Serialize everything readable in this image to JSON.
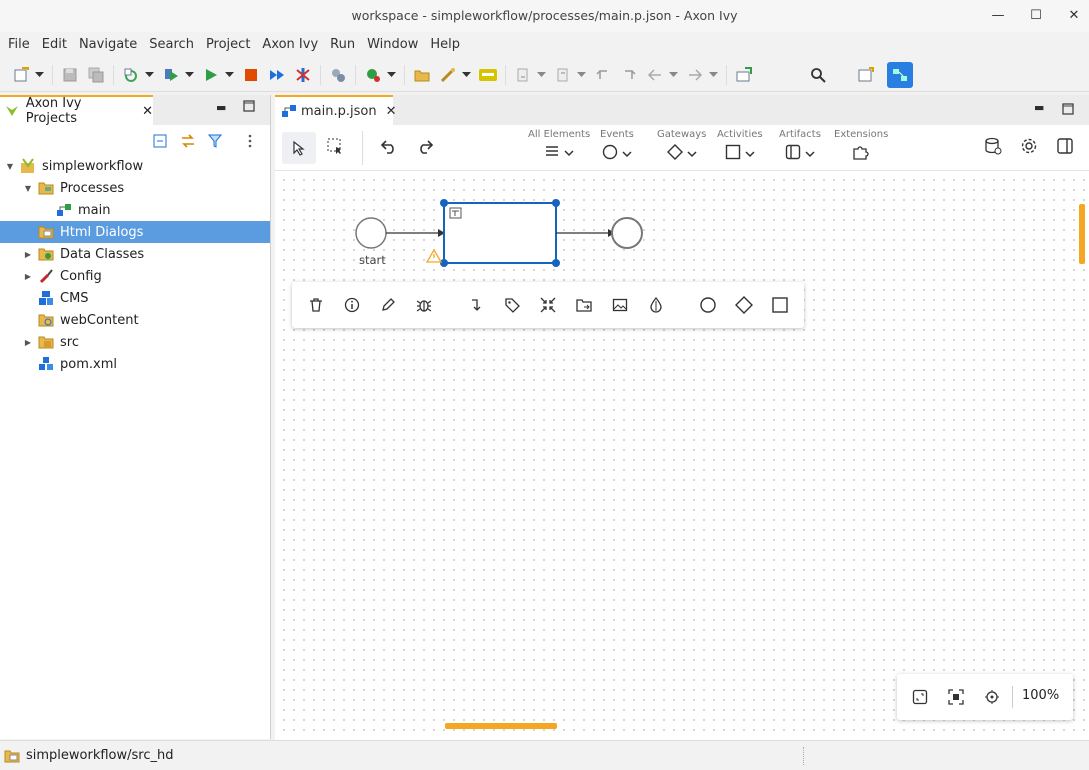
{
  "window": {
    "title": "workspace - simpleworkflow/processes/main.p.json - Axon Ivy",
    "minimize_icon": "minimize-icon",
    "maximize_icon": "maximize-icon",
    "close_icon": "close-icon"
  },
  "menu": [
    "File",
    "Edit",
    "Navigate",
    "Search",
    "Project",
    "Axon Ivy",
    "Run",
    "Window",
    "Help"
  ],
  "left_panel": {
    "tab_label": "Axon Ivy Projects",
    "tree": [
      {
        "label": "simpleworkflow",
        "icon": "project-icon"
      },
      {
        "label": "Processes",
        "icon": "folder-icon"
      },
      {
        "label": "main",
        "icon": "process-icon"
      },
      {
        "label": "Html Dialogs",
        "icon": "folder-icon"
      },
      {
        "label": "Data Classes",
        "icon": "folder-icon"
      },
      {
        "label": "Config",
        "icon": "config-icon"
      },
      {
        "label": "CMS",
        "icon": "cms-icon"
      },
      {
        "label": "webContent",
        "icon": "folder-icon"
      },
      {
        "label": "src",
        "icon": "folder-icon"
      },
      {
        "label": "pom.xml",
        "icon": "pom-icon"
      }
    ]
  },
  "editor": {
    "tab_label": "main.p.json",
    "palette": {
      "all_elements": "All Elements",
      "events": "Events",
      "gateways": "Gateways",
      "activities": "Activities",
      "artifacts": "Artifacts",
      "extensions": "Extensions"
    },
    "diagram": {
      "start_label": "start"
    },
    "zoom": "100%"
  },
  "status": {
    "path": "simpleworkflow/src_hd"
  },
  "colors": {
    "accent": "#f5a623",
    "selection": "#5b9be0",
    "element_selected": "#1565c0"
  }
}
